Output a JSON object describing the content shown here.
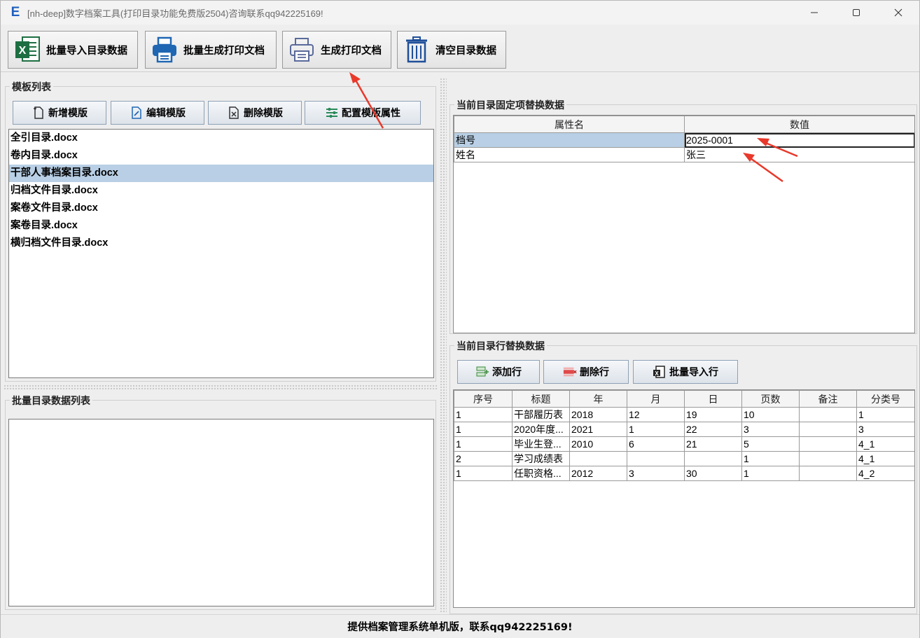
{
  "window": {
    "app_icon": "E",
    "title": "[nh-deep]数字档案工具(打印目录功能免费版2504)咨询联系qq942225169!",
    "controls": [
      "minimize-icon",
      "maximize-icon",
      "close-icon"
    ]
  },
  "toolbar": {
    "buttons": [
      {
        "label": "批量导入目录数据",
        "icon": "excel-icon"
      },
      {
        "label": "批量生成打印文档",
        "icon": "printer-icon"
      },
      {
        "label": "生成打印文档",
        "icon": "printer-outline-icon"
      },
      {
        "label": "清空目录数据",
        "icon": "trash-icon"
      }
    ]
  },
  "template_panel": {
    "title": "模板列表",
    "buttons": [
      {
        "label": "新增模版",
        "icon": "new-file-icon"
      },
      {
        "label": "编辑模版",
        "icon": "edit-file-icon"
      },
      {
        "label": "删除模版",
        "icon": "delete-file-icon"
      },
      {
        "label": "配置模版属性",
        "icon": "settings-sliders-icon"
      }
    ],
    "items": [
      {
        "name": "全引目录",
        "ext": ".docx",
        "selected": false
      },
      {
        "name": "卷内目录",
        "ext": ".docx",
        "selected": false
      },
      {
        "name": "干部人事档案目录",
        "ext": ".docx",
        "selected": true
      },
      {
        "name": "归档文件目录",
        "ext": ".docx",
        "selected": false
      },
      {
        "name": "案卷文件目录",
        "ext": ".docx",
        "selected": false
      },
      {
        "name": "案卷目录",
        "ext": ".docx",
        "selected": false
      },
      {
        "name": "横归档文件目录",
        "ext": ".docx",
        "selected": false
      }
    ]
  },
  "batch_panel": {
    "title": "批量目录数据列表"
  },
  "fixed_panel": {
    "title": "当前目录固定项替换数据",
    "columns": [
      "属性名",
      "数值"
    ],
    "rows": [
      {
        "name": "档号",
        "value": "2025-0001",
        "selected": true
      },
      {
        "name": "姓名",
        "value": "张三",
        "selected": false
      }
    ]
  },
  "row_panel": {
    "title": "当前目录行替换数据",
    "buttons": [
      {
        "label": "添加行",
        "icon": "add-row-icon"
      },
      {
        "label": "删除行",
        "icon": "delete-row-icon"
      },
      {
        "label": "批量导入行",
        "icon": "import-rows-icon"
      }
    ],
    "columns": [
      "序号",
      "标题",
      "年",
      "月",
      "日",
      "页数",
      "备注",
      "分类号"
    ],
    "rows": [
      [
        "1",
        "干部履历表",
        "2018",
        "12",
        "19",
        "10",
        "",
        "1"
      ],
      [
        "1",
        "2020年度...",
        "2021",
        "1",
        "22",
        "3",
        "",
        "3"
      ],
      [
        "1",
        "毕业生登...",
        "2010",
        "6",
        "21",
        "5",
        "",
        "4_1"
      ],
      [
        "2",
        "学习成绩表",
        "",
        "",
        "",
        "1",
        "",
        "4_1"
      ],
      [
        "1",
        "任职资格...",
        "2012",
        "3",
        "30",
        "1",
        "",
        "4_2"
      ]
    ]
  },
  "status": {
    "text": "提供档案管理系统单机版，联系qq942225169!"
  },
  "colors": {
    "selection": "#b8cfe5",
    "annotation_arrow": "#e8392b",
    "accent_blue": "#1f5fbf"
  }
}
